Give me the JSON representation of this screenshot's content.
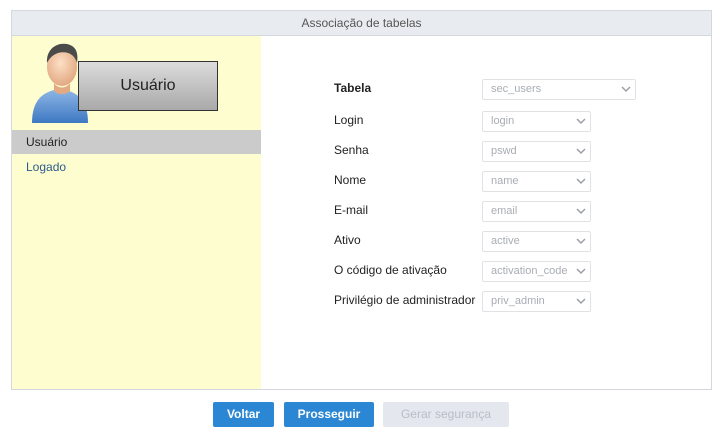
{
  "panel": {
    "title": "Associação de tabelas"
  },
  "sidebar": {
    "user_box_label": "Usuário",
    "items": [
      {
        "label": "Usuário",
        "active": true
      },
      {
        "label": "Logado",
        "active": false
      }
    ]
  },
  "form": {
    "rows": [
      {
        "label": "Tabela",
        "value": "sec_users"
      },
      {
        "label": "Login",
        "value": "login"
      },
      {
        "label": "Senha",
        "value": "pswd"
      },
      {
        "label": "Nome",
        "value": "name"
      },
      {
        "label": "E-mail",
        "value": "email"
      },
      {
        "label": "Ativo",
        "value": "active"
      },
      {
        "label": "O código de ativação",
        "value": "activation_code"
      },
      {
        "label": "Privilégio de administrador",
        "value": "priv_admin"
      }
    ]
  },
  "buttons": {
    "back": "Voltar",
    "next": "Prosseguir",
    "generate": "Gerar segurança"
  },
  "colors": {
    "sidebar_bg": "#fdfdd0",
    "primary": "#2b87d3",
    "disabled": "#e4e8ee"
  }
}
